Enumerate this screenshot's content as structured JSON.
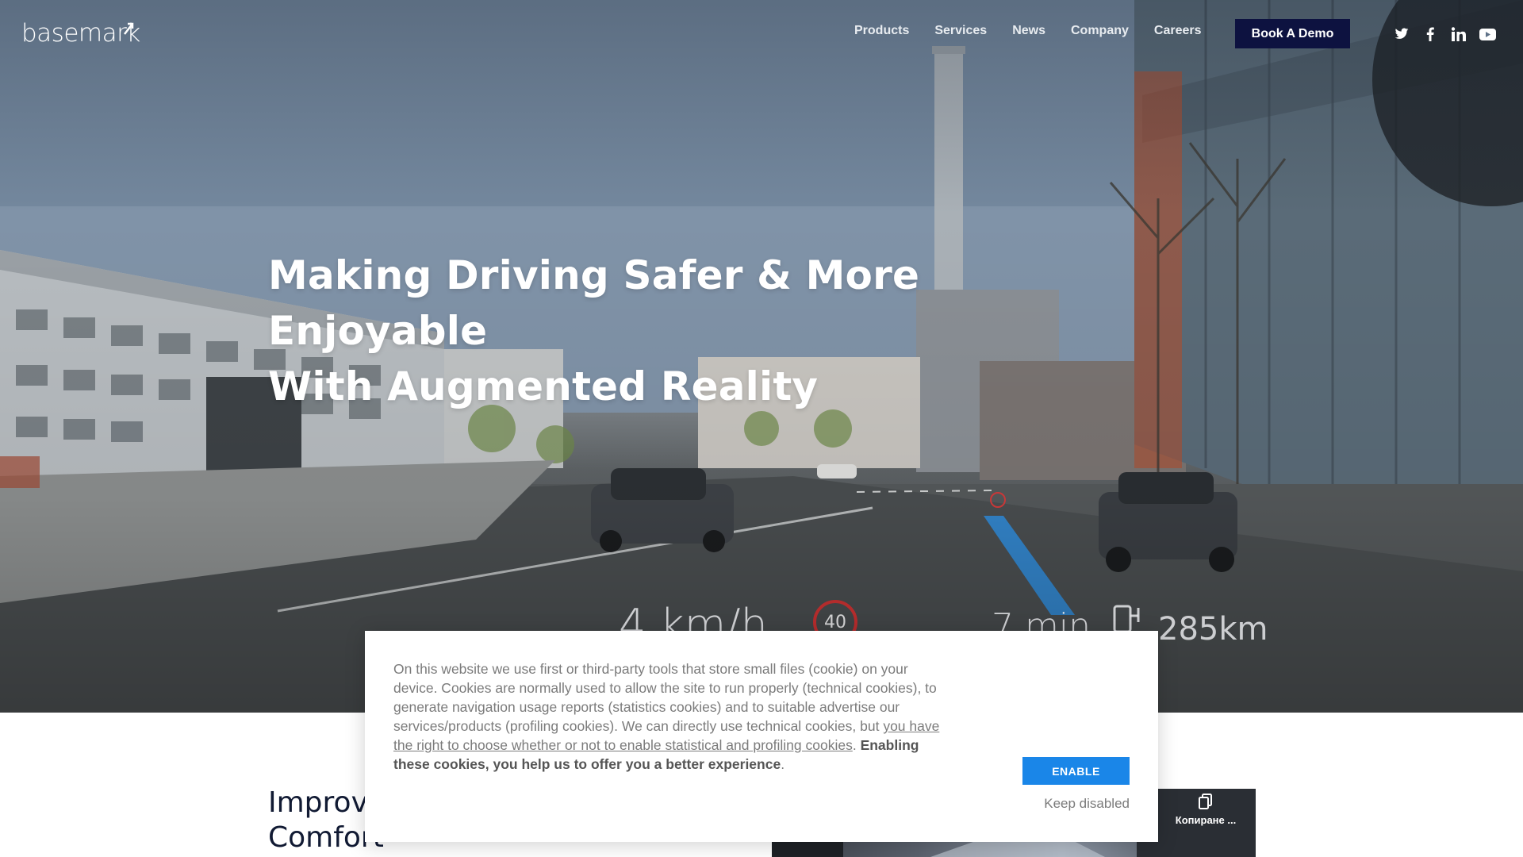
{
  "brand": {
    "logo_text": "basemark"
  },
  "nav": {
    "items": [
      {
        "label": "Products"
      },
      {
        "label": "Services"
      },
      {
        "label": "News"
      },
      {
        "label": "Company"
      },
      {
        "label": "Careers"
      }
    ],
    "cta_label": "Book A Demo",
    "social": [
      "twitter-icon",
      "facebook-icon",
      "linkedin-icon",
      "youtube-icon"
    ]
  },
  "hero": {
    "headline_line1": "Making Driving Safer & More Enjoyable",
    "headline_line2": "With Augmented Reality",
    "hud": {
      "speed": "4 km/h",
      "speed_limit": "40",
      "eta": "7 min",
      "range": "285km"
    }
  },
  "section": {
    "heading_line1": "Improv",
    "heading_line2": "Comfort"
  },
  "video": {
    "copy_label": "Копиране ..."
  },
  "cookie": {
    "text_intro": "On this website we use first or third-party tools that store small files (cookie) on your device. Cookies are normally used to allow the site to run properly (technical cookies), to generate navigation usage reports (statistics cookies) and to suitable advertise our services/products (profiling cookies). We can directly use technical cookies, but ",
    "link_text": "you have the right to choose whether or not to enable statistical and profiling cookies",
    "text_after_link": ". ",
    "strong_text": "Enabling these cookies, you help us to offer you a better experience",
    "text_end": ".",
    "enable_label": "ENABLE",
    "keep_label": "Keep disabled"
  },
  "colors": {
    "navy": "#0d1240",
    "accent_blue": "#1a86e8",
    "heading": "#111a33"
  }
}
